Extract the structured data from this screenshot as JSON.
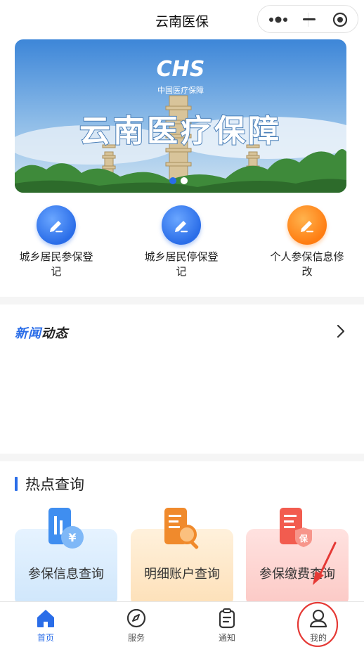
{
  "app": {
    "title": "云南医保"
  },
  "banner": {
    "logo_text": "CHS",
    "logo_subtitle": "中国医疗保障",
    "headline": "云南医疗保障"
  },
  "shortcuts": [
    {
      "label": "城乡居民参保登记",
      "icon": "edit-icon",
      "color": "#2a6de8"
    },
    {
      "label": "城乡居民停保登记",
      "icon": "edit-icon",
      "color": "#2a6de8"
    },
    {
      "label": "个人参保信息修改",
      "icon": "edit-icon",
      "color": "#ff7d12"
    }
  ],
  "news": {
    "title_part1": "新闻",
    "title_part2": "动态"
  },
  "hot": {
    "title": "热点查询",
    "cards": [
      {
        "label": "参保信息查询",
        "icon": "insurance-info-icon"
      },
      {
        "label": "明细账户查询",
        "icon": "account-detail-icon"
      },
      {
        "label": "参保缴费查询",
        "icon": "payment-query-icon"
      }
    ]
  },
  "tabs": [
    {
      "label": "首页",
      "icon": "home-icon",
      "active": true
    },
    {
      "label": "服务",
      "icon": "compass-icon",
      "active": false
    },
    {
      "label": "通知",
      "icon": "clipboard-icon",
      "active": false
    },
    {
      "label": "我的",
      "icon": "user-icon",
      "active": false
    }
  ],
  "colors": {
    "accent": "#2a6de8",
    "orange": "#ff7d12",
    "annotation": "#e53935"
  }
}
